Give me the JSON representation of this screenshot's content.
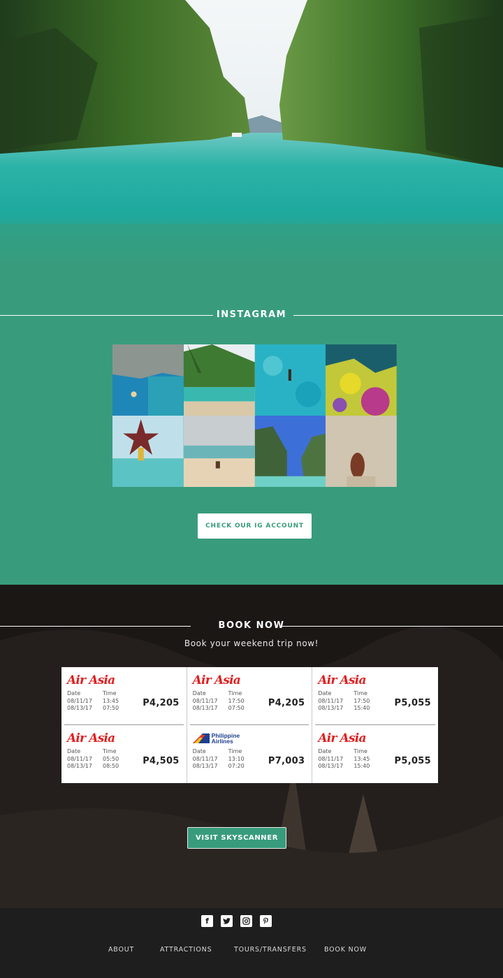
{
  "instagram": {
    "heading": "INSTAGRAM",
    "cta_label": "CHECK OUR IG ACCOUNT"
  },
  "book_now": {
    "heading": "BOOK NOW",
    "subtitle": "Book your weekend trip now!",
    "date_header": "Date",
    "time_header": "Time",
    "flights": [
      {
        "airline": "AirAsia",
        "dates": [
          "08/11/17",
          "08/13/17"
        ],
        "times": [
          "13:45",
          "07:50"
        ],
        "price": "P4,205"
      },
      {
        "airline": "AirAsia",
        "dates": [
          "08/11/17",
          "08/13/17"
        ],
        "times": [
          "17:50",
          "07:50"
        ],
        "price": "P4,205"
      },
      {
        "airline": "AirAsia",
        "dates": [
          "08/11/17",
          "08/13/17"
        ],
        "times": [
          "17:50",
          "15:40"
        ],
        "price": "P5,055"
      },
      {
        "airline": "AirAsia",
        "dates": [
          "08/11/17",
          "08/13/17"
        ],
        "times": [
          "05:50",
          "08:50"
        ],
        "price": "P4,505"
      },
      {
        "airline": "Philippine Airlines",
        "dates": [
          "08/11/17",
          "08/13/17"
        ],
        "times": [
          "13:10",
          "07:20"
        ],
        "price": "P7,003"
      },
      {
        "airline": "AirAsia",
        "dates": [
          "08/11/17",
          "08/13/17"
        ],
        "times": [
          "13:45",
          "15:40"
        ],
        "price": "P5,055"
      }
    ],
    "airline_logo_primary": "Air Asia",
    "pal_logo_line1": "Philippine",
    "pal_logo_line2": "Airlines",
    "cta_label": "VISIT SKYSCANNER"
  },
  "footer": {
    "social_icons": [
      "facebook-icon",
      "twitter-icon",
      "instagram-icon",
      "pinterest-icon"
    ],
    "nav": [
      {
        "label": "ABOUT"
      },
      {
        "label": "ATTRACTIONS"
      },
      {
        "label": "TOURS/TRANSFERS"
      },
      {
        "label": "BOOK NOW"
      }
    ]
  },
  "colors": {
    "brand_green": "#389c7c",
    "airasia_red": "#e02020",
    "footer_bg": "#1e1e1e"
  }
}
